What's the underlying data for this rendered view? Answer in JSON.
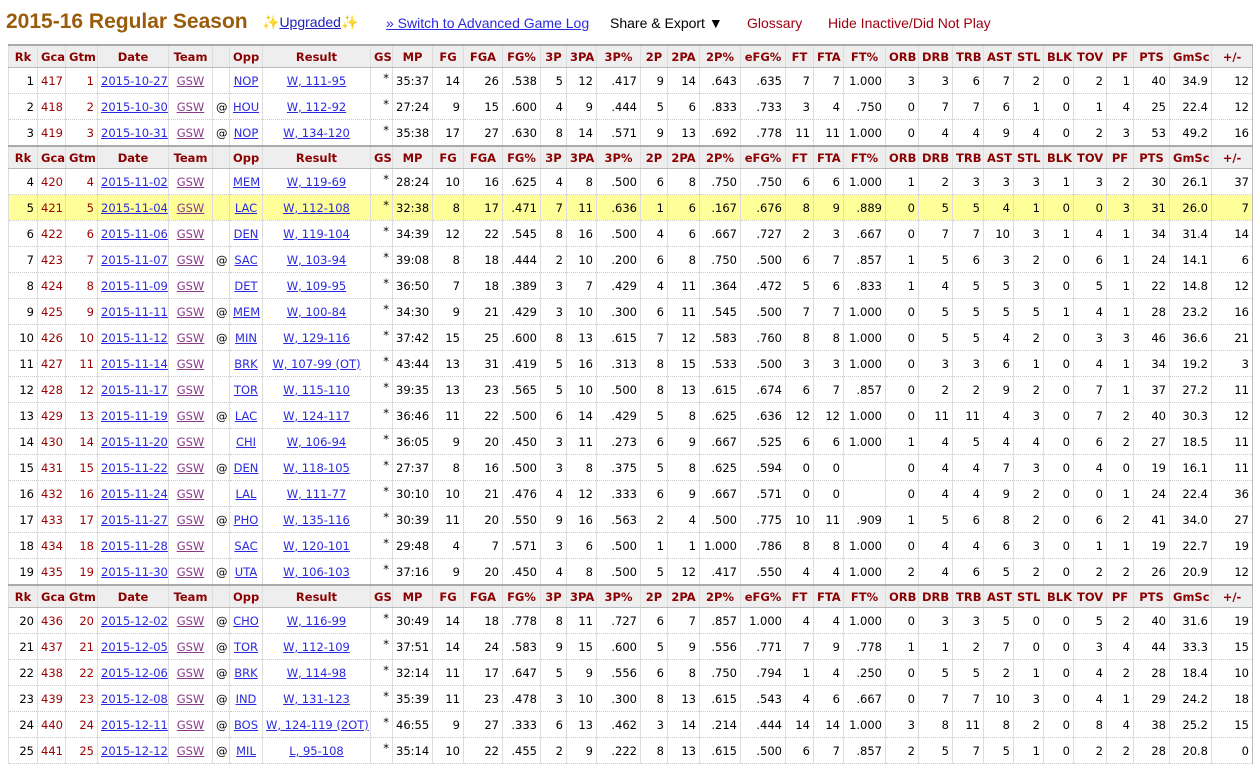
{
  "header": {
    "title": "2015-16 Regular Season",
    "sparkle": "✨",
    "upgraded": "Upgraded",
    "advanced_link": "» Switch to Advanced Game Log",
    "share_export": "Share & Export ▼",
    "glossary": "Glossary",
    "hide_inactive": "Hide Inactive/Did Not Play"
  },
  "columns": [
    "Rk",
    "Gcar",
    "Gtm",
    "Date",
    "Team",
    "",
    "Opp",
    "Result",
    "GS",
    "MP",
    "FG",
    "FGA",
    "FG%",
    "3P",
    "3PA",
    "3P%",
    "2P",
    "2PA",
    "2P%",
    "eFG%",
    "FT",
    "FTA",
    "FT%",
    "ORB",
    "DRB",
    "TRB",
    "AST",
    "STL",
    "BLK",
    "TOV",
    "PF",
    "PTS",
    "GmSc",
    "+/-"
  ],
  "highlight_row": 4,
  "colors": {
    "title": "#9a5c0a",
    "header_text": "#8b0000",
    "link": "#2a2ae0",
    "highlight": "#ffff99"
  },
  "games": [
    [
      "1",
      "417",
      "1",
      "2015-10-27",
      "GSW",
      "",
      "NOP",
      "W, 111-95",
      "*",
      "35:37",
      "14",
      "26",
      ".538",
      "5",
      "12",
      ".417",
      "9",
      "14",
      ".643",
      ".635",
      "7",
      "7",
      "1.000",
      "3",
      "3",
      "6",
      "7",
      "2",
      "0",
      "2",
      "1",
      "40",
      "34.9",
      "12"
    ],
    [
      "2",
      "418",
      "2",
      "2015-10-30",
      "GSW",
      "@",
      "HOU",
      "W, 112-92",
      "*",
      "27:24",
      "9",
      "15",
      ".600",
      "4",
      "9",
      ".444",
      "5",
      "6",
      ".833",
      ".733",
      "3",
      "4",
      ".750",
      "0",
      "7",
      "7",
      "6",
      "1",
      "0",
      "1",
      "4",
      "25",
      "22.4",
      "12"
    ],
    [
      "3",
      "419",
      "3",
      "2015-10-31",
      "GSW",
      "@",
      "NOP",
      "W, 134-120",
      "*",
      "35:38",
      "17",
      "27",
      ".630",
      "8",
      "14",
      ".571",
      "9",
      "13",
      ".692",
      ".778",
      "11",
      "11",
      "1.000",
      "0",
      "4",
      "4",
      "9",
      "4",
      "0",
      "2",
      "3",
      "53",
      "49.2",
      "16"
    ],
    [
      "4",
      "420",
      "4",
      "2015-11-02",
      "GSW",
      "",
      "MEM",
      "W, 119-69",
      "*",
      "28:24",
      "10",
      "16",
      ".625",
      "4",
      "8",
      ".500",
      "6",
      "8",
      ".750",
      ".750",
      "6",
      "6",
      "1.000",
      "1",
      "2",
      "3",
      "3",
      "3",
      "1",
      "3",
      "2",
      "30",
      "26.1",
      "37"
    ],
    [
      "5",
      "421",
      "5",
      "2015-11-04",
      "GSW",
      "",
      "LAC",
      "W, 112-108",
      "*",
      "32:38",
      "8",
      "17",
      ".471",
      "7",
      "11",
      ".636",
      "1",
      "6",
      ".167",
      ".676",
      "8",
      "9",
      ".889",
      "0",
      "5",
      "5",
      "4",
      "1",
      "0",
      "0",
      "3",
      "31",
      "26.0",
      "7"
    ],
    [
      "6",
      "422",
      "6",
      "2015-11-06",
      "GSW",
      "",
      "DEN",
      "W, 119-104",
      "*",
      "34:39",
      "12",
      "22",
      ".545",
      "8",
      "16",
      ".500",
      "4",
      "6",
      ".667",
      ".727",
      "2",
      "3",
      ".667",
      "0",
      "7",
      "7",
      "10",
      "3",
      "1",
      "4",
      "1",
      "34",
      "31.4",
      "14"
    ],
    [
      "7",
      "423",
      "7",
      "2015-11-07",
      "GSW",
      "@",
      "SAC",
      "W, 103-94",
      "*",
      "39:08",
      "8",
      "18",
      ".444",
      "2",
      "10",
      ".200",
      "6",
      "8",
      ".750",
      ".500",
      "6",
      "7",
      ".857",
      "1",
      "5",
      "6",
      "3",
      "2",
      "0",
      "6",
      "1",
      "24",
      "14.1",
      "6"
    ],
    [
      "8",
      "424",
      "8",
      "2015-11-09",
      "GSW",
      "",
      "DET",
      "W, 109-95",
      "*",
      "36:50",
      "7",
      "18",
      ".389",
      "3",
      "7",
      ".429",
      "4",
      "11",
      ".364",
      ".472",
      "5",
      "6",
      ".833",
      "1",
      "4",
      "5",
      "5",
      "3",
      "0",
      "5",
      "1",
      "22",
      "14.8",
      "12"
    ],
    [
      "9",
      "425",
      "9",
      "2015-11-11",
      "GSW",
      "@",
      "MEM",
      "W, 100-84",
      "*",
      "34:30",
      "9",
      "21",
      ".429",
      "3",
      "10",
      ".300",
      "6",
      "11",
      ".545",
      ".500",
      "7",
      "7",
      "1.000",
      "0",
      "5",
      "5",
      "5",
      "5",
      "1",
      "4",
      "1",
      "28",
      "23.2",
      "16"
    ],
    [
      "10",
      "426",
      "10",
      "2015-11-12",
      "GSW",
      "@",
      "MIN",
      "W, 129-116",
      "*",
      "37:42",
      "15",
      "25",
      ".600",
      "8",
      "13",
      ".615",
      "7",
      "12",
      ".583",
      ".760",
      "8",
      "8",
      "1.000",
      "0",
      "5",
      "5",
      "4",
      "2",
      "0",
      "3",
      "3",
      "46",
      "36.6",
      "21"
    ],
    [
      "11",
      "427",
      "11",
      "2015-11-14",
      "GSW",
      "",
      "BRK",
      "W, 107-99 (OT)",
      "*",
      "43:44",
      "13",
      "31",
      ".419",
      "5",
      "16",
      ".313",
      "8",
      "15",
      ".533",
      ".500",
      "3",
      "3",
      "1.000",
      "0",
      "3",
      "3",
      "6",
      "1",
      "0",
      "4",
      "1",
      "34",
      "19.2",
      "3"
    ],
    [
      "12",
      "428",
      "12",
      "2015-11-17",
      "GSW",
      "",
      "TOR",
      "W, 115-110",
      "*",
      "39:35",
      "13",
      "23",
      ".565",
      "5",
      "10",
      ".500",
      "8",
      "13",
      ".615",
      ".674",
      "6",
      "7",
      ".857",
      "0",
      "2",
      "2",
      "9",
      "2",
      "0",
      "7",
      "1",
      "37",
      "27.2",
      "11"
    ],
    [
      "13",
      "429",
      "13",
      "2015-11-19",
      "GSW",
      "@",
      "LAC",
      "W, 124-117",
      "*",
      "36:46",
      "11",
      "22",
      ".500",
      "6",
      "14",
      ".429",
      "5",
      "8",
      ".625",
      ".636",
      "12",
      "12",
      "1.000",
      "0",
      "11",
      "11",
      "4",
      "3",
      "0",
      "7",
      "2",
      "40",
      "30.3",
      "12"
    ],
    [
      "14",
      "430",
      "14",
      "2015-11-20",
      "GSW",
      "",
      "CHI",
      "W, 106-94",
      "*",
      "36:05",
      "9",
      "20",
      ".450",
      "3",
      "11",
      ".273",
      "6",
      "9",
      ".667",
      ".525",
      "6",
      "6",
      "1.000",
      "1",
      "4",
      "5",
      "4",
      "4",
      "0",
      "6",
      "2",
      "27",
      "18.5",
      "11"
    ],
    [
      "15",
      "431",
      "15",
      "2015-11-22",
      "GSW",
      "@",
      "DEN",
      "W, 118-105",
      "*",
      "27:37",
      "8",
      "16",
      ".500",
      "3",
      "8",
      ".375",
      "5",
      "8",
      ".625",
      ".594",
      "0",
      "0",
      "",
      "0",
      "4",
      "4",
      "7",
      "3",
      "0",
      "4",
      "0",
      "19",
      "16.1",
      "11"
    ],
    [
      "16",
      "432",
      "16",
      "2015-11-24",
      "GSW",
      "",
      "LAL",
      "W, 111-77",
      "*",
      "30:10",
      "10",
      "21",
      ".476",
      "4",
      "12",
      ".333",
      "6",
      "9",
      ".667",
      ".571",
      "0",
      "0",
      "",
      "0",
      "4",
      "4",
      "9",
      "2",
      "0",
      "0",
      "1",
      "24",
      "22.4",
      "36"
    ],
    [
      "17",
      "433",
      "17",
      "2015-11-27",
      "GSW",
      "@",
      "PHO",
      "W, 135-116",
      "*",
      "30:39",
      "11",
      "20",
      ".550",
      "9",
      "16",
      ".563",
      "2",
      "4",
      ".500",
      ".775",
      "10",
      "11",
      ".909",
      "1",
      "5",
      "6",
      "8",
      "2",
      "0",
      "6",
      "2",
      "41",
      "34.0",
      "27"
    ],
    [
      "18",
      "434",
      "18",
      "2015-11-28",
      "GSW",
      "",
      "SAC",
      "W, 120-101",
      "*",
      "29:48",
      "4",
      "7",
      ".571",
      "3",
      "6",
      ".500",
      "1",
      "1",
      "1.000",
      ".786",
      "8",
      "8",
      "1.000",
      "0",
      "4",
      "4",
      "6",
      "3",
      "0",
      "1",
      "1",
      "19",
      "22.7",
      "19"
    ],
    [
      "19",
      "435",
      "19",
      "2015-11-30",
      "GSW",
      "@",
      "UTA",
      "W, 106-103",
      "*",
      "37:16",
      "9",
      "20",
      ".450",
      "4",
      "8",
      ".500",
      "5",
      "12",
      ".417",
      ".550",
      "4",
      "4",
      "1.000",
      "2",
      "4",
      "6",
      "5",
      "2",
      "0",
      "2",
      "2",
      "26",
      "20.9",
      "12"
    ],
    [
      "20",
      "436",
      "20",
      "2015-12-02",
      "GSW",
      "@",
      "CHO",
      "W, 116-99",
      "*",
      "30:49",
      "14",
      "18",
      ".778",
      "8",
      "11",
      ".727",
      "6",
      "7",
      ".857",
      "1.000",
      "4",
      "4",
      "1.000",
      "0",
      "3",
      "3",
      "5",
      "0",
      "0",
      "5",
      "2",
      "40",
      "31.6",
      "19"
    ],
    [
      "21",
      "437",
      "21",
      "2015-12-05",
      "GSW",
      "@",
      "TOR",
      "W, 112-109",
      "*",
      "37:51",
      "14",
      "24",
      ".583",
      "9",
      "15",
      ".600",
      "5",
      "9",
      ".556",
      ".771",
      "7",
      "9",
      ".778",
      "1",
      "1",
      "2",
      "7",
      "0",
      "0",
      "3",
      "4",
      "44",
      "33.3",
      "15"
    ],
    [
      "22",
      "438",
      "22",
      "2015-12-06",
      "GSW",
      "@",
      "BRK",
      "W, 114-98",
      "*",
      "32:14",
      "11",
      "17",
      ".647",
      "5",
      "9",
      ".556",
      "6",
      "8",
      ".750",
      ".794",
      "1",
      "4",
      ".250",
      "0",
      "5",
      "5",
      "2",
      "1",
      "0",
      "4",
      "2",
      "28",
      "18.4",
      "10"
    ],
    [
      "23",
      "439",
      "23",
      "2015-12-08",
      "GSW",
      "@",
      "IND",
      "W, 131-123",
      "*",
      "35:39",
      "11",
      "23",
      ".478",
      "3",
      "10",
      ".300",
      "8",
      "13",
      ".615",
      ".543",
      "4",
      "6",
      ".667",
      "0",
      "7",
      "7",
      "10",
      "3",
      "0",
      "4",
      "1",
      "29",
      "24.2",
      "18"
    ],
    [
      "24",
      "440",
      "24",
      "2015-12-11",
      "GSW",
      "@",
      "BOS",
      "W, 124-119 (2OT)",
      "*",
      "46:55",
      "9",
      "27",
      ".333",
      "6",
      "13",
      ".462",
      "3",
      "14",
      ".214",
      ".444",
      "14",
      "14",
      "1.000",
      "3",
      "8",
      "11",
      "8",
      "2",
      "0",
      "8",
      "4",
      "38",
      "25.2",
      "15"
    ],
    [
      "25",
      "441",
      "25",
      "2015-12-12",
      "GSW",
      "@",
      "MIL",
      "L, 95-108",
      "*",
      "35:14",
      "10",
      "22",
      ".455",
      "2",
      "9",
      ".222",
      "8",
      "13",
      ".615",
      ".500",
      "6",
      "7",
      ".857",
      "2",
      "5",
      "7",
      "5",
      "1",
      "0",
      "2",
      "2",
      "28",
      "20.8",
      "0"
    ]
  ]
}
